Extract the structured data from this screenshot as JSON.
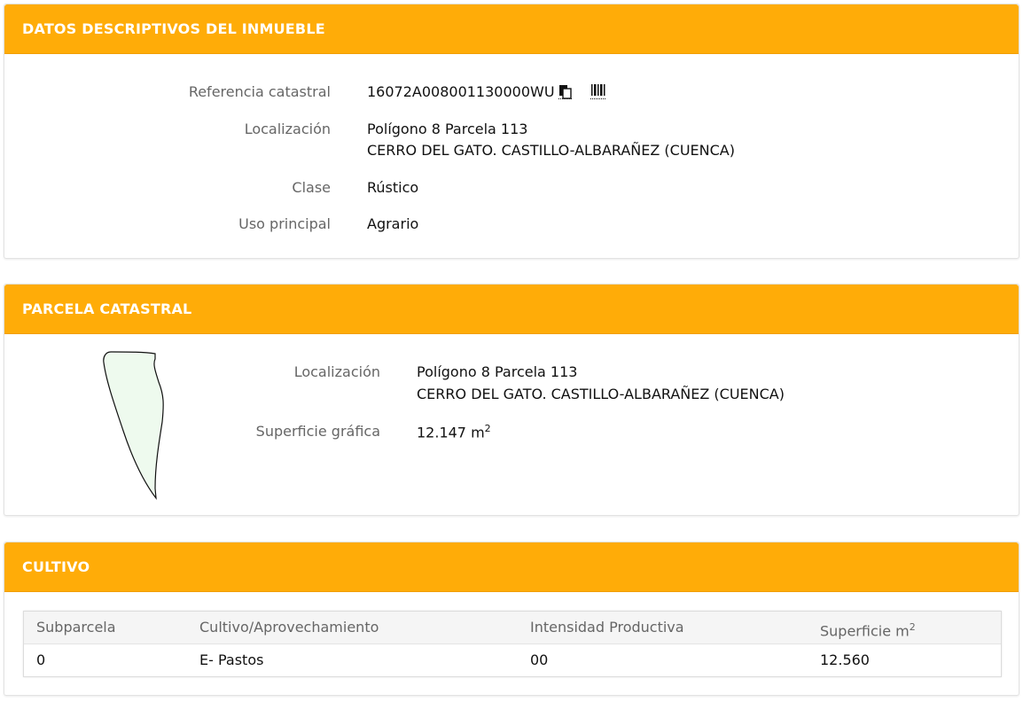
{
  "descriptivos": {
    "title": "DATOS DESCRIPTIVOS DEL INMUEBLE",
    "ref_label": "Referencia catastral",
    "ref_value": "16072A008001130000WU",
    "copy_icon": "copy-icon",
    "barcode_icon": "barcode-icon",
    "loc_label": "Localización",
    "loc_line1": "Polígono 8 Parcela 113",
    "loc_line2": "CERRO DEL GATO. CASTILLO-ALBARAÑEZ (CUENCA)",
    "clase_label": "Clase",
    "clase_value": "Rústico",
    "uso_label": "Uso principal",
    "uso_value": "Agrario"
  },
  "parcela": {
    "title": "PARCELA CATASTRAL",
    "loc_label": "Localización",
    "loc_line1": "Polígono 8 Parcela 113",
    "loc_line2": "CERRO DEL GATO. CASTILLO-ALBARAÑEZ (CUENCA)",
    "sup_label": "Superficie gráfica",
    "sup_value": "12.147 m",
    "sup_exp": "2",
    "shape_fill": "#eefaee",
    "shape_stroke": "#111111"
  },
  "cultivo": {
    "title": "CULTIVO",
    "headers": {
      "subparcela": "Subparcela",
      "cultivo": "Cultivo/Aprovechamiento",
      "intensidad": "Intensidad Productiva",
      "superficie": "Superficie m",
      "superficie_exp": "2"
    },
    "rows": [
      {
        "subparcela": "0",
        "cultivo": "E- Pastos",
        "intensidad": "00",
        "superficie": "12.560"
      }
    ]
  },
  "colors": {
    "header_bg": "#ffac08",
    "header_text": "#ffffff"
  }
}
